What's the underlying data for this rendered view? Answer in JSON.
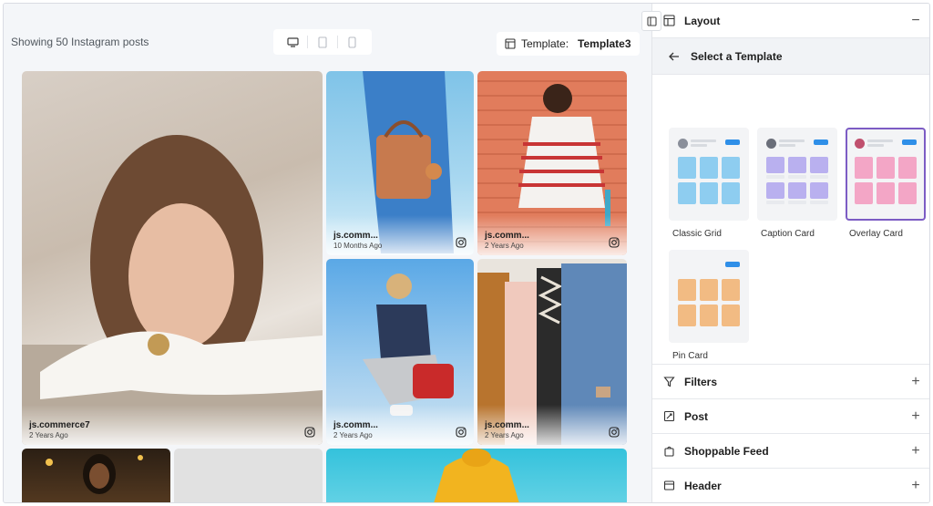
{
  "header": {
    "showing": "Showing 50 Instagram posts",
    "template_label": "Template:",
    "template_value": "Template3"
  },
  "devices": [
    "desktop-icon",
    "tablet-icon",
    "mobile-icon"
  ],
  "posts": [
    {
      "user": "js.commerce7",
      "ago": "2 Years Ago"
    },
    {
      "user": "js.comm...",
      "ago": "10 Months Ago"
    },
    {
      "user": "js.comm...",
      "ago": "2 Years Ago"
    },
    {
      "user": "js.comm...",
      "ago": "2 Years Ago"
    },
    {
      "user": "js.comm...",
      "ago": "2 Years Ago"
    }
  ],
  "sidebar": {
    "layout_title": "Layout",
    "select_template": "Select a Template",
    "templates": [
      {
        "name": "Classic Grid",
        "color": "#8ecdf0"
      },
      {
        "name": "Caption Card",
        "color": "#b9b0ef"
      },
      {
        "name": "Overlay Card",
        "color": "#f3a6c6"
      },
      {
        "name": "Pin Card",
        "color": "#f2bb83"
      }
    ],
    "selected_template": "Overlay Card",
    "sections": [
      {
        "title": "Filters",
        "icon": "filter-icon"
      },
      {
        "title": "Post",
        "icon": "post-icon"
      },
      {
        "title": "Shoppable Feed",
        "icon": "shopping-bag-icon"
      },
      {
        "title": "Header",
        "icon": "header-icon"
      }
    ]
  },
  "colors": {
    "accent": "#7c5cc4",
    "button": "#2f8fe8"
  }
}
